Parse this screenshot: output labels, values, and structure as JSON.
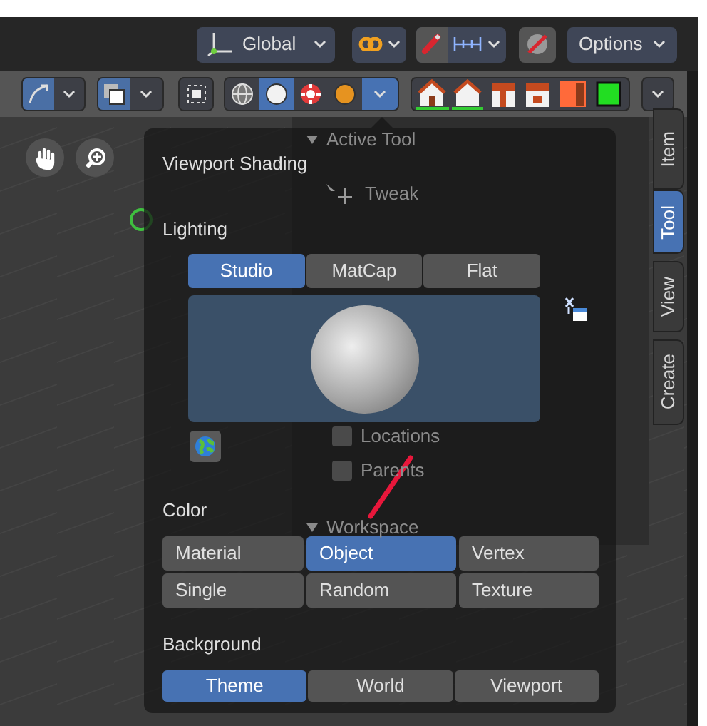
{
  "header": {
    "orientation": {
      "label": "Global"
    },
    "options": {
      "label": "Options"
    }
  },
  "toolbar": {
    "shading_modes": [
      {
        "kind": "wireframe",
        "selected": false
      },
      {
        "kind": "solid",
        "selected": true
      },
      {
        "kind": "material",
        "selected": false
      },
      {
        "kind": "rendered",
        "selected": false
      }
    ],
    "shading_menu": {
      "open": true
    }
  },
  "sidebar": {
    "tabs": [
      {
        "label": "Item",
        "selected": false
      },
      {
        "label": "Tool",
        "selected": true
      },
      {
        "label": "View",
        "selected": false
      },
      {
        "label": "Create",
        "selected": false
      }
    ],
    "panel": [
      {
        "kind": "header",
        "text": "Active Tool"
      },
      {
        "kind": "tool",
        "text": "Tweak"
      },
      {
        "kind": "checkbox",
        "text": "Locations",
        "checked": false
      },
      {
        "kind": "checkbox",
        "text": "Parents",
        "checked": false
      },
      {
        "kind": "header",
        "text": "Workspace"
      }
    ]
  },
  "popup": {
    "title": "Viewport Shading",
    "lighting": {
      "label": "Lighting",
      "options": [
        {
          "label": "Studio",
          "selected": true
        },
        {
          "label": "MatCap",
          "selected": false
        },
        {
          "label": "Flat",
          "selected": false
        }
      ]
    },
    "color": {
      "label": "Color",
      "options": [
        {
          "label": "Material",
          "selected": false
        },
        {
          "label": "Object",
          "selected": true
        },
        {
          "label": "Vertex",
          "selected": false
        },
        {
          "label": "Single",
          "selected": false
        },
        {
          "label": "Random",
          "selected": false
        },
        {
          "label": "Texture",
          "selected": false
        }
      ]
    },
    "background": {
      "label": "Background",
      "options": [
        {
          "label": "Theme",
          "selected": true
        },
        {
          "label": "World",
          "selected": false
        },
        {
          "label": "Viewport",
          "selected": false
        }
      ]
    }
  }
}
